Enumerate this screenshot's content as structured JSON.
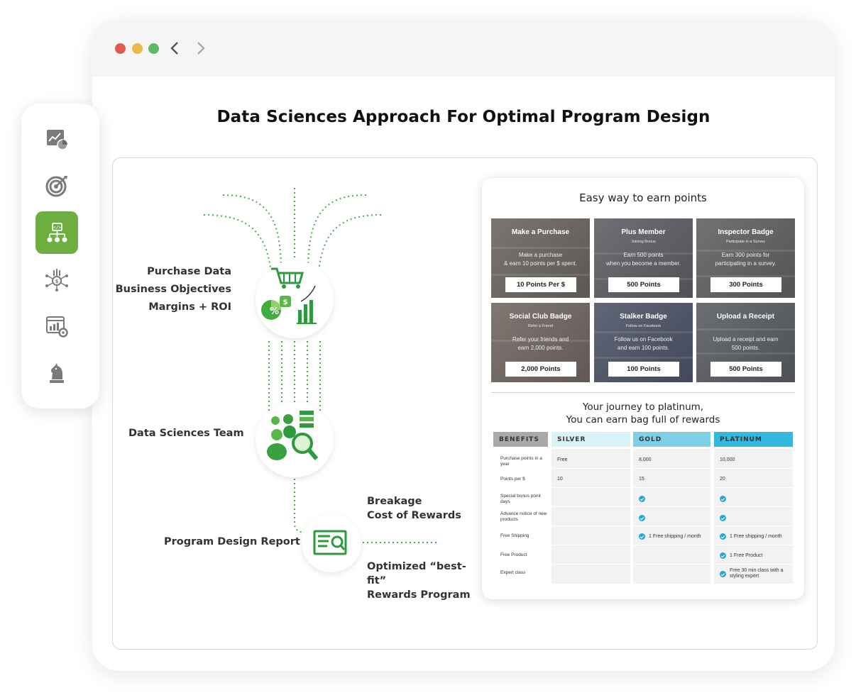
{
  "page": {
    "title": "Data Sciences Approach For Optimal Program Design"
  },
  "sidebar": {
    "items": [
      {
        "icon": "analytics-chart-icon",
        "active": false
      },
      {
        "icon": "target-icon",
        "active": false
      },
      {
        "icon": "code-hierarchy-icon",
        "active": true
      },
      {
        "icon": "growth-network-icon",
        "active": false
      },
      {
        "icon": "dashboard-settings-icon",
        "active": false
      },
      {
        "icon": "chess-knight-icon",
        "active": false
      }
    ]
  },
  "diagram": {
    "inputs": [
      "Purchase Data",
      "Business Objectives",
      "Margins + ROI"
    ],
    "team": "Data Sciences Team",
    "report": "Program Design Report",
    "outputs_top": [
      "Breakage",
      "Cost of Rewards"
    ],
    "outputs_bottom": [
      "Optimized “best-fit”",
      "Rewards Program"
    ]
  },
  "earn": {
    "title": "Easy way to earn points",
    "tiles": [
      {
        "name": "Make a Purchase",
        "sub": "",
        "desc": "Make a purchase\n& earn 10 points per $ spent.",
        "button": "10 Points Per $"
      },
      {
        "name": "Plus Member",
        "sub": "Joining Bonus",
        "desc": "Earn 500 points\nwhen you become a member.",
        "button": "500 Points"
      },
      {
        "name": "Inspector Badge",
        "sub": "Participate in a Survey",
        "desc": "Earn 300 points for\nparticipating in a survey.",
        "button": "300 Points"
      },
      {
        "name": "Social Club Badge",
        "sub": "Refer a Friend",
        "desc": "Refer your friends and\nearn 2,000 points.",
        "button": "2,000 Points"
      },
      {
        "name": "Stalker Badge",
        "sub": "Follow on Facebook",
        "desc": "Follow us on Facebook\nand earn 100 points.",
        "button": "100 Points"
      },
      {
        "name": "Upload a Receipt",
        "sub": "",
        "desc": "Upload a receipt and earn\n500 points.",
        "button": "500 Points"
      }
    ]
  },
  "journey": {
    "title_line1": "Your journey to platinum,",
    "title_line2": "You can earn bag full of rewards",
    "headers": [
      "BENEFITS",
      "SILVER",
      "GOLD",
      "PLATINUM"
    ],
    "colors": {
      "benefits": "#a9a9a9",
      "silver": "#d9f1f8",
      "gold": "#7fd0e6",
      "platinum": "#33b9e0"
    },
    "rows": [
      {
        "label": "Purchase points in a year",
        "silver": "Free",
        "gold": "8,000",
        "platinum": "10,000"
      },
      {
        "label": "Points per $",
        "silver": "10",
        "gold": "15",
        "platinum": "20"
      },
      {
        "label": "Special bonus point days",
        "silver": "",
        "gold": "check",
        "platinum": "check"
      },
      {
        "label": "Advance notice of new products",
        "silver": "",
        "gold": "check",
        "platinum": "check"
      },
      {
        "label": "Free Shipping",
        "silver": "",
        "gold": "1 Free shipping / month",
        "platinum": "1 Free shipping / month"
      },
      {
        "label": "Free Product",
        "silver": "",
        "gold": "",
        "platinum": "1 Free Product"
      },
      {
        "label": "Expert class",
        "silver": "",
        "gold": "",
        "platinum": "Free 30 min class with a styling expert"
      }
    ]
  },
  "colors": {
    "accent": "#6cae3f",
    "check": "#28a8d0"
  }
}
